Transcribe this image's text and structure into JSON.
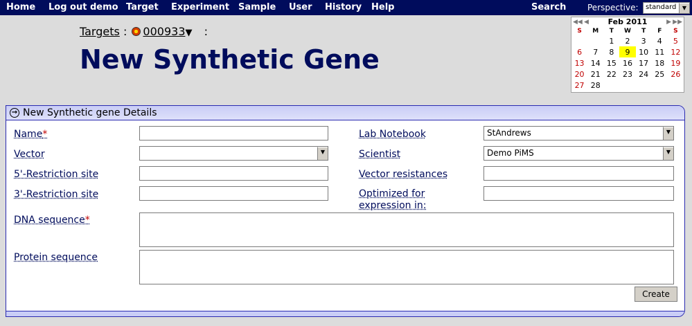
{
  "nav": {
    "items": [
      "Home",
      "Log out demo",
      "Target",
      "Experiment",
      "Sample",
      "User",
      "History",
      "Help"
    ],
    "search": "Search",
    "perspective_label": "Perspective:",
    "perspective_value": "standard"
  },
  "breadcrumb": {
    "link": "Targets",
    "sep": ":",
    "target": "000933",
    "dropdown": "▼",
    "trail": ":"
  },
  "title": "New Synthetic Gene",
  "calendar": {
    "month": "Feb 2011",
    "prev_year": "◀◀",
    "prev_month": "◀",
    "next_month": "▶",
    "next_year": "▶▶",
    "weekdays": [
      "S",
      "M",
      "T",
      "W",
      "T",
      "F",
      "S"
    ],
    "weeks": [
      [
        "",
        "",
        "1",
        "2",
        "3",
        "4",
        "5"
      ],
      [
        "6",
        "7",
        "8",
        "9",
        "10",
        "11",
        "12"
      ],
      [
        "13",
        "14",
        "15",
        "16",
        "17",
        "18",
        "19"
      ],
      [
        "20",
        "21",
        "22",
        "23",
        "24",
        "25",
        "26"
      ],
      [
        "27",
        "28",
        "",
        "",
        "",
        "",
        ""
      ]
    ],
    "today": "9"
  },
  "panel": {
    "title": "New Synthetic gene Details",
    "fields": {
      "name": {
        "label": "Name",
        "required": "*",
        "value": ""
      },
      "vector": {
        "label": "Vector",
        "value": ""
      },
      "five_site": {
        "label": "5'-Restriction site",
        "value": ""
      },
      "three_site": {
        "label": "3'-Restriction site",
        "value": ""
      },
      "dna": {
        "label": "DNA sequence",
        "required": "*",
        "value": ""
      },
      "protein": {
        "label": "Protein sequence",
        "value": ""
      },
      "lab_notebook": {
        "label": "Lab Notebook",
        "value": "StAndrews"
      },
      "scientist": {
        "label": "Scientist",
        "value": "Demo PiMS"
      },
      "resistances": {
        "label": "Vector resistances",
        "value": ""
      },
      "optimized": {
        "label": "Optimized for expression in:",
        "value": ""
      }
    },
    "create_label": "Create"
  }
}
